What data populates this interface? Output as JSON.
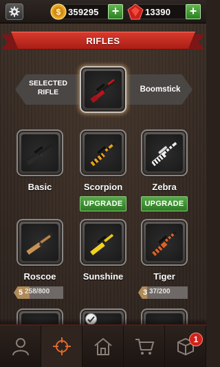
{
  "top_bar": {
    "coins": "359295",
    "gems": "13390",
    "plus_label": "+"
  },
  "header": {
    "title": "RIFLES"
  },
  "selected": {
    "label": "SELECTED\nRIFLE",
    "name": "Boomstick"
  },
  "rifles": [
    {
      "name": "Basic",
      "icon": "basic-rifle-icon"
    },
    {
      "name": "Scorpion",
      "icon": "scorpion-rifle-icon",
      "button": "UPGRADE"
    },
    {
      "name": "Zebra",
      "icon": "zebra-rifle-icon",
      "button": "UPGRADE"
    },
    {
      "name": "Roscoe",
      "icon": "roscoe-rifle-icon",
      "level": "5",
      "progress": "258/800",
      "progress_fraction": 0.3225
    },
    {
      "name": "Sunshine",
      "icon": "sunshine-rifle-icon"
    },
    {
      "name": "Tiger",
      "icon": "tiger-rifle-icon",
      "level": "3",
      "progress": "37/200",
      "progress_fraction": 0.185
    }
  ],
  "bottom_nav": {
    "items": [
      "profile-icon",
      "crosshair-icon",
      "house-icon",
      "cart-icon",
      "box-icon"
    ],
    "active": "crosshair-icon",
    "box_badge": "1"
  },
  "colors": {
    "ribbon": "#c2281f",
    "upgrade_green": "#3f8f33",
    "accent_orange": "#d9632b"
  }
}
